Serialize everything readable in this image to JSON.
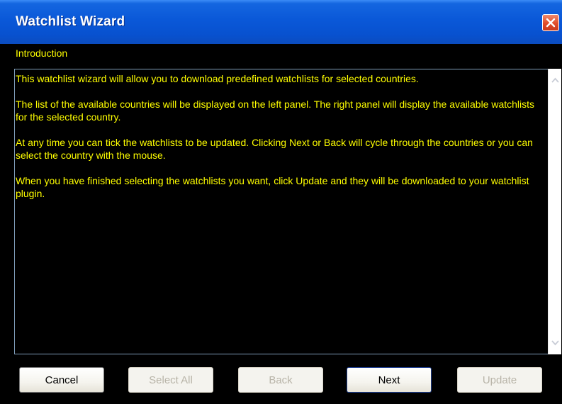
{
  "window": {
    "title": "Watchlist Wizard"
  },
  "page": {
    "heading": "Introduction",
    "paragraphs": [
      "This watchlist wizard will allow you to download predefined watchlists for selected countries.",
      "The list of the available countries will be displayed on the left panel. The right panel will display the available watchlists for the selected country.",
      "At any time you can tick the watchlists to be updated. Clicking Next or Back will cycle through the countries or you can select the country with the mouse.",
      "When you have finished selecting the watchlists you want, click Update and they will be downloaded to your watchlist plugin."
    ]
  },
  "buttons": {
    "cancel": "Cancel",
    "select_all": "Select All",
    "back": "Back",
    "next": "Next",
    "update": "Update"
  },
  "icons": {
    "close": "close-icon",
    "scroll_up": "scroll-up-arrow-icon",
    "scroll_down": "scroll-down-arrow-icon"
  },
  "colors": {
    "text_accent": "#ffff00",
    "background": "#000000",
    "titlebar": "#0a58d8",
    "close_button": "#e04d2a"
  }
}
